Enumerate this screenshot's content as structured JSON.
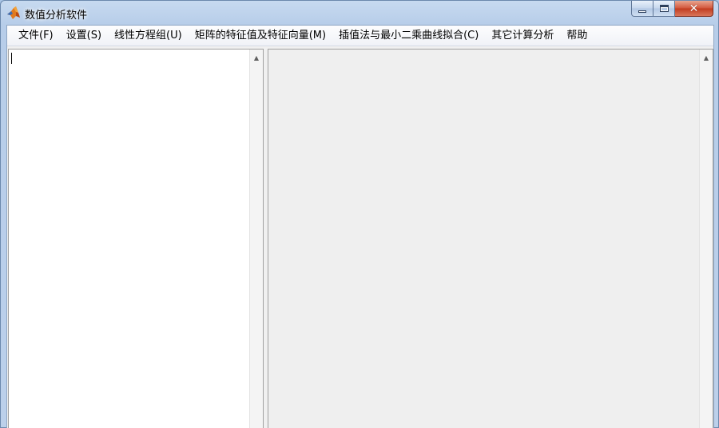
{
  "window": {
    "title": "数值分析软件",
    "icon": "matlab-logo-icon",
    "controls": {
      "minimize": "minimize-icon",
      "maximize": "maximize-icon",
      "close": "close-icon",
      "close_glyph": "✕"
    }
  },
  "menubar": {
    "items": [
      {
        "label": "文件(F)"
      },
      {
        "label": "设置(S)"
      },
      {
        "label": "线性方程组(U)"
      },
      {
        "label": "矩阵的特征值及特征向量(M)"
      },
      {
        "label": "插值法与最小二乘曲线拟合(C)"
      },
      {
        "label": "其它计算分析"
      },
      {
        "label": "帮助"
      }
    ]
  },
  "left_pane": {
    "text": "",
    "scroll_up_glyph": "▲"
  },
  "right_pane": {
    "text": "",
    "scroll_up_glyph": "▲"
  },
  "colors": {
    "window_frame": "#b7cde9",
    "client_bg": "#f0f0f0",
    "edit_bg": "#ffffff",
    "close_button": "#c13c1f"
  }
}
